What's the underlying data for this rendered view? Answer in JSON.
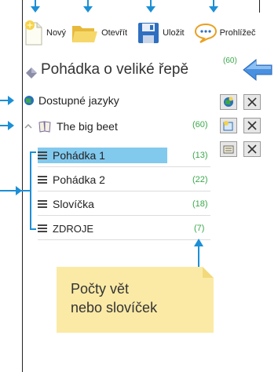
{
  "toolbar": {
    "new_label": "Nový",
    "open_label": "Otevřít",
    "save_label": "Uložit",
    "viewer_label": "Prohlížeč"
  },
  "header": {
    "title": "Pohádka o veliké řepě",
    "count": "(60)"
  },
  "tree": {
    "languages_label": "Dostupné jazyky",
    "book_label": "The big beet",
    "book_count": "(60)",
    "chapters": [
      {
        "label": "Pohádka 1",
        "count": "(13)",
        "selected": true
      },
      {
        "label": "Pohádka 2",
        "count": "(22)",
        "selected": false
      },
      {
        "label": "Slovíčka",
        "count": "(18)",
        "selected": false
      },
      {
        "label": "ZDROJE",
        "count": "(7)",
        "selected": false
      }
    ]
  },
  "callout": {
    "line1": "Počty vět",
    "line2": "nebo slovíček"
  },
  "colors": {
    "accent": "#1c8fd6",
    "count_green": "#3aa84a",
    "selection": "#82c9ee",
    "callout_bg": "#fbeaa6"
  }
}
